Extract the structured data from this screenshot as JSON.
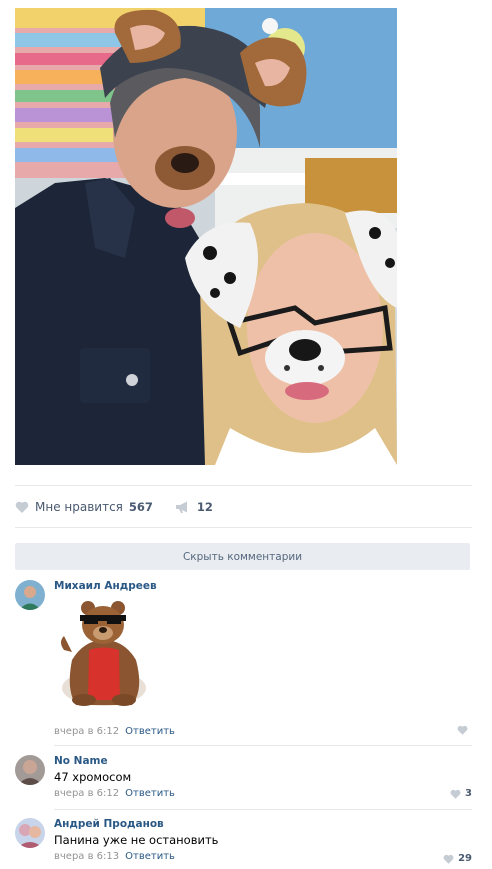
{
  "post": {
    "likes_label": "Мне нравится",
    "likes_count": "567",
    "shares_count": "12",
    "hide_comments_label": "Скрыть комментарии"
  },
  "comments": [
    {
      "author": "Михаил Андреев",
      "text": "",
      "time": "вчера в 6:12",
      "reply_label": "Ответить",
      "likes": ""
    },
    {
      "author": "No Name",
      "text": "47 хромосом",
      "time": "вчера в 6:12",
      "reply_label": "Ответить",
      "likes": "3"
    },
    {
      "author": "Андрей Проданов",
      "text": "Панина уже не остановить",
      "time": "вчера в 6:13",
      "reply_label": "Ответить",
      "likes": "29"
    }
  ],
  "icons": {
    "like": "heart-icon",
    "share": "megaphone-icon",
    "sticker": "bear-sticker"
  },
  "colors": {
    "link": "#2a5885",
    "muted": "#939393",
    "action": "#5b6c83",
    "bar": "#e9edf1",
    "divider": "#e7e8ec"
  }
}
